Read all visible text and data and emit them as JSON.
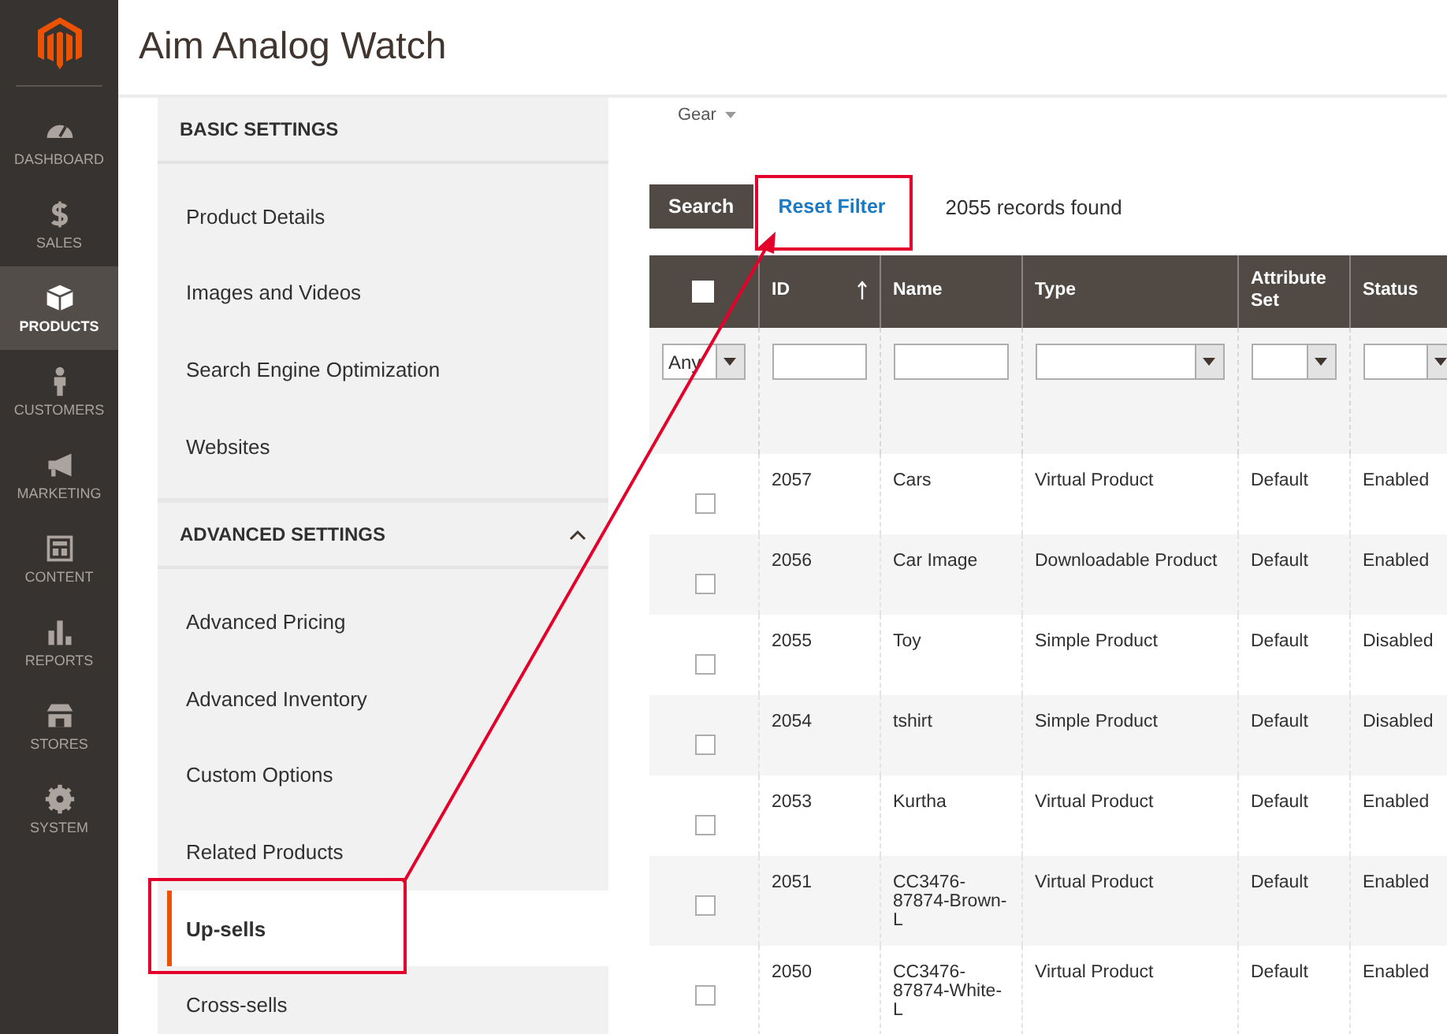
{
  "nav": {
    "items": [
      {
        "label": "DASHBOARD",
        "kind": "gauge",
        "selected": false
      },
      {
        "label": "SALES",
        "kind": "dollar",
        "selected": false
      },
      {
        "label": "PRODUCTS",
        "kind": "box",
        "selected": true
      },
      {
        "label": "CUSTOMERS",
        "kind": "person",
        "selected": false
      },
      {
        "label": "MARKETING",
        "kind": "megaphone",
        "selected": false
      },
      {
        "label": "CONTENT",
        "kind": "layout",
        "selected": false
      },
      {
        "label": "REPORTS",
        "kind": "bars",
        "selected": false
      },
      {
        "label": "STORES",
        "kind": "store",
        "selected": false
      },
      {
        "label": "SYSTEM",
        "kind": "gear",
        "selected": false
      }
    ]
  },
  "header": {
    "title": "Aim Analog Watch"
  },
  "sections": [
    {
      "title": "BASIC SETTINGS",
      "items": [
        {
          "label": "Product Details",
          "selected": false,
          "highlighted": false
        },
        {
          "label": "Images and Videos",
          "selected": false,
          "highlighted": false
        },
        {
          "label": "Search Engine Optimization",
          "selected": false,
          "highlighted": false
        },
        {
          "label": "Websites",
          "selected": false,
          "highlighted": false
        }
      ]
    },
    {
      "title": "ADVANCED SETTINGS",
      "expanded": true,
      "items": [
        {
          "label": "Advanced Pricing",
          "selected": false,
          "highlighted": false
        },
        {
          "label": "Advanced Inventory",
          "selected": false,
          "highlighted": false
        },
        {
          "label": "Custom Options",
          "selected": false,
          "highlighted": false
        },
        {
          "label": "Related Products",
          "selected": false,
          "highlighted": false
        },
        {
          "label": "Up-sells",
          "selected": true,
          "highlighted": true
        },
        {
          "label": "Cross-sells",
          "selected": false,
          "highlighted": false
        }
      ]
    }
  ],
  "store_switcher": {
    "value": "Gear"
  },
  "toolbar": {
    "buttons": [
      {
        "label": "Search",
        "kind": "primary",
        "highlighted": false
      },
      {
        "label": "Reset Filter",
        "kind": "link",
        "highlighted": true
      }
    ],
    "records": "2055 records found"
  },
  "table": {
    "columns": [
      {
        "kind": "checkbox",
        "checked": false
      },
      {
        "label": "ID",
        "sorted": true
      },
      {
        "label": "Name"
      },
      {
        "label": "Type"
      },
      {
        "label": "Attribute Set"
      },
      {
        "label": "Status"
      }
    ],
    "filters": [
      {
        "kind": "select",
        "value": "Any"
      },
      {
        "kind": "text"
      },
      {
        "kind": "text"
      },
      {
        "kind": "select"
      },
      {
        "kind": "select"
      },
      {
        "kind": "select"
      }
    ],
    "rows": [
      {
        "checked": false,
        "id": "2057",
        "name": "Cars",
        "type": "Virtual Product",
        "attribute_set": "Default",
        "status": "Enabled"
      },
      {
        "checked": false,
        "id": "2056",
        "name": "Car Image",
        "type": "Downloadable Product",
        "attribute_set": "Default",
        "status": "Enabled"
      },
      {
        "checked": false,
        "id": "2055",
        "name": "Toy",
        "type": "Simple Product",
        "attribute_set": "Default",
        "status": "Disabled"
      },
      {
        "checked": false,
        "id": "2054",
        "name": "tshirt",
        "type": "Simple Product",
        "attribute_set": "Default",
        "status": "Disabled"
      },
      {
        "checked": false,
        "id": "2053",
        "name": "Kurtha",
        "type": "Virtual Product",
        "attribute_set": "Default",
        "status": "Enabled"
      },
      {
        "checked": false,
        "id": "2051",
        "name": "CC3476-87874-Brown-L",
        "type": "Virtual Product",
        "attribute_set": "Default",
        "status": "Enabled"
      },
      {
        "checked": false,
        "id": "2050",
        "name": "CC3476-87874-White-L",
        "type": "Virtual Product",
        "attribute_set": "Default",
        "status": "Enabled"
      }
    ]
  }
}
